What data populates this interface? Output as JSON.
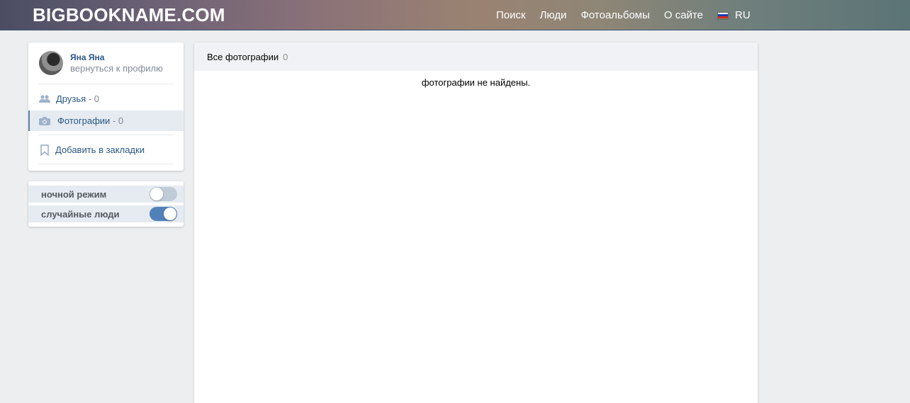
{
  "header": {
    "logo": "BIGBOOKNAME.COM",
    "nav": [
      "Поиск",
      "Люди",
      "Фотоальбомы",
      "О сайте"
    ],
    "lang": "RU"
  },
  "profile": {
    "name": "Яна Яна",
    "back_link": "вернуться к профилю"
  },
  "menu": {
    "friends_label": "Друзья",
    "friends_count": " - 0",
    "photos_label": "Фотографии",
    "photos_count": " - 0",
    "bookmark_label": "Добавить в закладки"
  },
  "toggles": {
    "night_label": "ночной режим",
    "night_on": false,
    "random_label": "случайные люди",
    "random_on": true
  },
  "main": {
    "tab_label": "Все фотографии",
    "tab_count": "0",
    "empty_message": "фотографии не найдены."
  },
  "colors": {
    "link": "#2a5885",
    "muted": "#828a99",
    "toggle_on": "#5181b8",
    "toggle_off": "#c0cbd8"
  },
  "icons": {
    "friends": "friends-icon",
    "photos": "camera-icon",
    "bookmark": "bookmark-icon",
    "flag": "russia-flag-icon"
  }
}
